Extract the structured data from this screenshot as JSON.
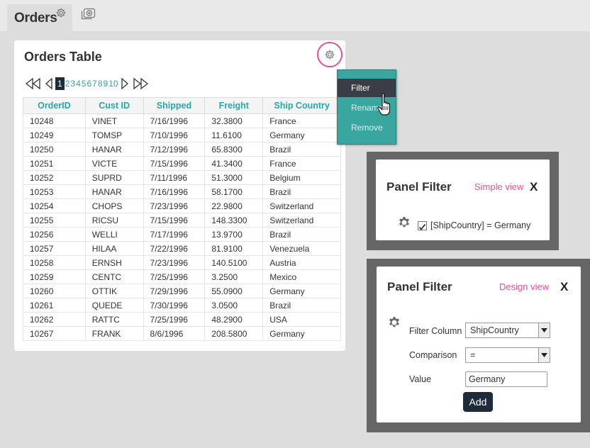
{
  "tab": {
    "title": "Orders"
  },
  "panel": {
    "title": "Orders Table"
  },
  "pager": {
    "current": "1",
    "pages": [
      "2",
      "3",
      "4",
      "5",
      "6",
      "7",
      "8",
      "9",
      "10"
    ]
  },
  "table": {
    "headers": [
      "OrderID",
      "Cust ID",
      "Shipped",
      "Freight",
      "Ship Country"
    ],
    "rows": [
      [
        "10248",
        "VINET",
        "7/16/1996",
        "32.3800",
        "France"
      ],
      [
        "10249",
        "TOMSP",
        "7/10/1996",
        "11.6100",
        "Germany"
      ],
      [
        "10250",
        "HANAR",
        "7/12/1996",
        "65.8300",
        "Brazil"
      ],
      [
        "10251",
        "VICTE",
        "7/15/1996",
        "41.3400",
        "France"
      ],
      [
        "10252",
        "SUPRD",
        "7/11/1996",
        "51.3000",
        "Belgium"
      ],
      [
        "10253",
        "HANAR",
        "7/16/1996",
        "58.1700",
        "Brazil"
      ],
      [
        "10254",
        "CHOPS",
        "7/23/1996",
        "22.9800",
        "Switzerland"
      ],
      [
        "10255",
        "RICSU",
        "7/15/1996",
        "148.3300",
        "Switzerland"
      ],
      [
        "10256",
        "WELLI",
        "7/17/1996",
        "13.9700",
        "Brazil"
      ],
      [
        "10257",
        "HILAA",
        "7/22/1996",
        "81.9100",
        "Venezuela"
      ],
      [
        "10258",
        "ERNSH",
        "7/23/1996",
        "140.5100",
        "Austria"
      ],
      [
        "10259",
        "CENTC",
        "7/25/1996",
        "3.2500",
        "Mexico"
      ],
      [
        "10260",
        "OTTIK",
        "7/29/1996",
        "55.0900",
        "Germany"
      ],
      [
        "10261",
        "QUEDE",
        "7/30/1996",
        "3.0500",
        "Brazil"
      ],
      [
        "10262",
        "RATTC",
        "7/25/1996",
        "48.2900",
        "USA"
      ],
      [
        "10267",
        "FRANK",
        "8/6/1996",
        "208.5800",
        "Germany"
      ]
    ]
  },
  "menu": {
    "items": [
      "Filter",
      "Rename",
      "Remove"
    ]
  },
  "filter_simple": {
    "title": "Panel Filter",
    "view_link": "Simple view",
    "close": "X",
    "expression": "[ShipCountry] = Germany",
    "checked": true
  },
  "filter_design": {
    "title": "Panel Filter",
    "view_link": "Design view",
    "close": "X",
    "filter_column_label": "Filter Column",
    "filter_column_value": "ShipCountry",
    "comparison_label": "Comparison",
    "comparison_value": "=",
    "value_label": "Value",
    "value_value": "Germany",
    "add_button": "Add"
  },
  "colors": {
    "accent": "#2aa6a6",
    "link": "#e0529c",
    "dark": "#1e2b3a",
    "menu": "#3aa6a0"
  }
}
